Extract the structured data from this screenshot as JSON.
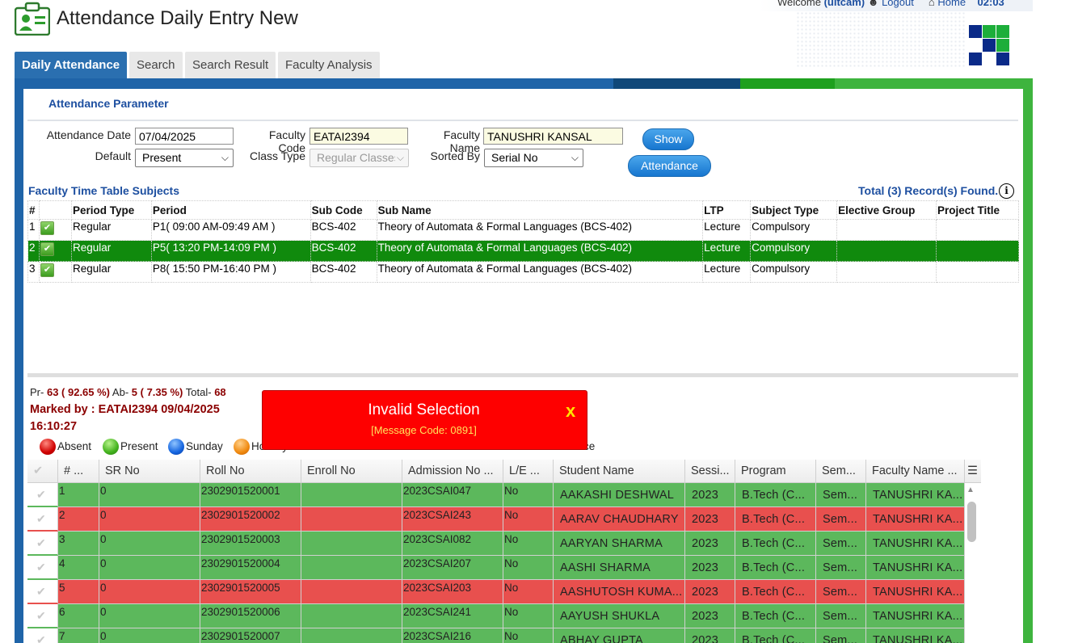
{
  "header": {
    "title": "Attendance Daily Entry New",
    "welcome_prefix": "Welcome",
    "user": "(uitcam)",
    "logout": "Logout",
    "home": "Home",
    "time": "02:03"
  },
  "tabs": [
    "Daily Attendance",
    "Search",
    "Search Result",
    "Faculty Analysis"
  ],
  "params": {
    "section_title": "Attendance Parameter",
    "attendance_date_label": "Attendance Date",
    "attendance_date": "07/04/2025",
    "faculty_code_label": "Faculty Code",
    "faculty_code": "EATAI2394",
    "faculty_name_label": "Faculty Name",
    "faculty_name": "TANUSHRI KANSAL",
    "default_label": "Default",
    "default_value": "Present",
    "class_type_label": "Class Type",
    "class_type_value": "Regular Classes",
    "sorted_by_label": "Sorted By",
    "sorted_by_value": "Serial No",
    "show_button": "Show",
    "attendance_button": "Attendance"
  },
  "timetable": {
    "title": "Faculty Time Table Subjects",
    "record_count": "Total (3) Record(s) Found.",
    "columns": [
      "#",
      "",
      "Period Type",
      "Period",
      "Sub Code",
      "Sub Name",
      "LTP",
      "Subject Type",
      "Elective Group",
      "Project Title"
    ],
    "rows": [
      {
        "n": "1",
        "period_type": "Regular",
        "period": "P1( 09:00 AM-09:49 AM )",
        "sub_code": "BCS-402",
        "sub_name": "Theory of Automata & Formal Languages (BCS-402)",
        "ltp": "Lecture",
        "subject_type": "Compulsory",
        "elective": "",
        "project": ""
      },
      {
        "n": "2",
        "period_type": "Regular",
        "period": "P5( 13:20 PM-14:09 PM )",
        "sub_code": "BCS-402",
        "sub_name": "Theory of Automata & Formal Languages (BCS-402)",
        "ltp": "Lecture",
        "subject_type": "Compulsory",
        "elective": "",
        "project": ""
      },
      {
        "n": "3",
        "period_type": "Regular",
        "period": "P8( 15:50 PM-16:40 PM )",
        "sub_code": "BCS-402",
        "sub_name": "Theory of Automata & Formal Languages (BCS-402)",
        "ltp": "Lecture",
        "subject_type": "Compulsory",
        "elective": "",
        "project": ""
      }
    ]
  },
  "stats": {
    "pr_label": "Pr-",
    "pr_value": "63 ( 92.65 %)",
    "ab_label": "Ab-",
    "ab_value": "5 ( 7.35 %)",
    "total_label": "Total-",
    "total_value": "68",
    "marked_by": "Marked by : EATAI2394 09/04/2025",
    "marked_time": "16:10:27"
  },
  "legend": {
    "absent": "Absent",
    "present": "Present",
    "sunday": "Sunday",
    "holiday": "Holiday",
    "trailing_text": "ce"
  },
  "colors": {
    "present_row": "#5cb85c",
    "absent_row": "#e8504e",
    "selected_row": "#108a0d",
    "popup": "#fe0000"
  },
  "grid": {
    "columns": [
      "# ...",
      "SR No",
      "Roll No",
      "Enroll No",
      "Admission No ...",
      "L/E ...",
      "Student Name",
      "Sessi...",
      "Program",
      "Sem...",
      "Faculty Name ..."
    ],
    "rows": [
      {
        "n": "1",
        "sr": "0",
        "roll": "2302901520001",
        "enroll": "",
        "adm": "2023CSAI047",
        "le": "No",
        "name": "AAKASHI DESHWAL",
        "session": "2023",
        "program": "B.Tech (C...",
        "sem": "Sem...",
        "faculty": "TANUSHRI KA...",
        "status": "present"
      },
      {
        "n": "2",
        "sr": "0",
        "roll": "2302901520002",
        "enroll": "",
        "adm": "2023CSAI243",
        "le": "No",
        "name": "AARAV CHAUDHARY",
        "session": "2023",
        "program": "B.Tech (C...",
        "sem": "Sem...",
        "faculty": "TANUSHRI KA...",
        "status": "absent"
      },
      {
        "n": "3",
        "sr": "0",
        "roll": "2302901520003",
        "enroll": "",
        "adm": "2023CSAI082",
        "le": "No",
        "name": "AARYAN SHARMA",
        "session": "2023",
        "program": "B.Tech (C...",
        "sem": "Sem...",
        "faculty": "TANUSHRI KA...",
        "status": "present"
      },
      {
        "n": "4",
        "sr": "0",
        "roll": "2302901520004",
        "enroll": "",
        "adm": "2023CSAI207",
        "le": "No",
        "name": "AASHI SHARMA",
        "session": "2023",
        "program": "B.Tech (C...",
        "sem": "Sem...",
        "faculty": "TANUSHRI KA...",
        "status": "present"
      },
      {
        "n": "5",
        "sr": "0",
        "roll": "2302901520005",
        "enroll": "",
        "adm": "2023CSAI203",
        "le": "No",
        "name": "AASHUTOSH KUMA...",
        "session": "2023",
        "program": "B.Tech (C...",
        "sem": "Sem...",
        "faculty": "TANUSHRI KA...",
        "status": "absent"
      },
      {
        "n": "6",
        "sr": "0",
        "roll": "2302901520006",
        "enroll": "",
        "adm": "2023CSAI241",
        "le": "No",
        "name": "AAYUSH SHUKLA",
        "session": "2023",
        "program": "B.Tech (C...",
        "sem": "Sem...",
        "faculty": "TANUSHRI KA...",
        "status": "present"
      },
      {
        "n": "7",
        "sr": "0",
        "roll": "2302901520007",
        "enroll": "",
        "adm": "2023CSAI216",
        "le": "No",
        "name": "ABHAY GUPTA",
        "session": "2023",
        "program": "B.Tech (C...",
        "sem": "Sem...",
        "faculty": "TANUSHRI KA...",
        "status": "present"
      }
    ]
  },
  "popup": {
    "title": "Invalid Selection",
    "code": "[Message Code: 0891]",
    "close": "x"
  }
}
